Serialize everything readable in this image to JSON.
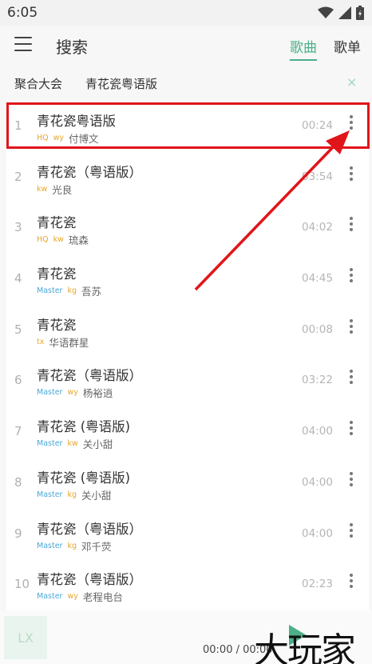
{
  "status": {
    "time": "6:05",
    "icons": [
      "wifi-icon",
      "signal-icon",
      "battery-icon"
    ]
  },
  "header": {
    "title": "搜索",
    "tabs": [
      "歌曲",
      "歌单"
    ],
    "active_tab": "歌曲"
  },
  "search": {
    "source": "聚合大会",
    "query": "青花瓷粤语版",
    "clear_icon": "×"
  },
  "songs": [
    {
      "index": "1",
      "name": "青花瓷粤语版",
      "quality": "HQ",
      "source": "wy",
      "singer": "付博文",
      "duration": "00:24"
    },
    {
      "index": "2",
      "name": "青花瓷（粤语版）",
      "quality": "",
      "source": "kw",
      "singer": "光良",
      "duration": "03:54"
    },
    {
      "index": "3",
      "name": "青花瓷",
      "quality": "HQ",
      "source": "kw",
      "singer": "琉森",
      "duration": "04:02"
    },
    {
      "index": "4",
      "name": "青花瓷",
      "quality": "Master",
      "source": "kg",
      "singer": "吾苏",
      "duration": "04:45"
    },
    {
      "index": "5",
      "name": "青花瓷",
      "quality": "",
      "source": "tx",
      "singer": "华语群星",
      "duration": "00:08"
    },
    {
      "index": "6",
      "name": "青花瓷（粤语版）",
      "quality": "Master",
      "source": "wy",
      "singer": "杨裕逍",
      "duration": "03:22"
    },
    {
      "index": "7",
      "name": "青花瓷 (粤语版)",
      "quality": "Master",
      "source": "kw",
      "singer": "关小甜",
      "duration": "04:00"
    },
    {
      "index": "8",
      "name": "青花瓷 (粤语版)",
      "quality": "Master",
      "source": "kg",
      "singer": "关小甜",
      "duration": "04:00"
    },
    {
      "index": "9",
      "name": "青花瓷（粤语版）",
      "quality": "Master",
      "source": "kg",
      "singer": "邓千荧",
      "duration": "04:00"
    },
    {
      "index": "10",
      "name": "青花瓷（粤语版）",
      "quality": "Master",
      "source": "wy",
      "singer": "老程电台",
      "duration": "02:23"
    }
  ],
  "player": {
    "cover_text": "LX",
    "time": "00:00 / 00:00"
  },
  "watermark": "大玩家",
  "colors": {
    "accent": "#4caf87",
    "highlight": "#e0151a",
    "quality": "#e8a62b",
    "master": "#4aa8d8"
  }
}
